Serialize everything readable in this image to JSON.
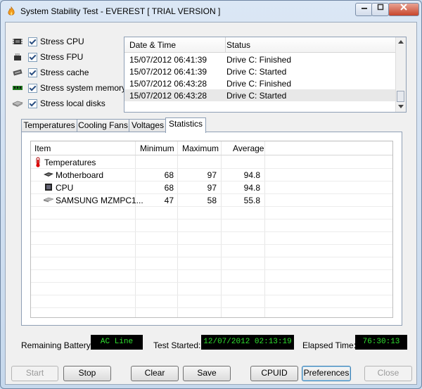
{
  "window": {
    "title": "System Stability Test - EVEREST  [ TRIAL VERSION ]"
  },
  "stress_options": [
    {
      "label": "Stress CPU",
      "icon": "cpu-icon",
      "checked": true
    },
    {
      "label": "Stress FPU",
      "icon": "fpu-icon",
      "checked": true
    },
    {
      "label": "Stress cache",
      "icon": "cache-icon",
      "checked": true
    },
    {
      "label": "Stress system memory",
      "icon": "memory-icon",
      "checked": true
    },
    {
      "label": "Stress local disks",
      "icon": "disk-icon",
      "checked": true
    }
  ],
  "log": {
    "columns": [
      "Date & Time",
      "Status"
    ],
    "rows": [
      {
        "time": "15/07/2012 06:41:39",
        "status": "Drive C: Finished"
      },
      {
        "time": "15/07/2012 06:41:39",
        "status": "Drive C: Started"
      },
      {
        "time": "15/07/2012 06:43:28",
        "status": "Drive C: Finished"
      },
      {
        "time": "15/07/2012 06:43:28",
        "status": "Drive C: Started"
      }
    ]
  },
  "tabs": [
    "Temperatures",
    "Cooling Fans",
    "Voltages",
    "Statistics"
  ],
  "active_tab": "Statistics",
  "statistics": {
    "columns": [
      "Item",
      "Minimum",
      "Maximum",
      "Average"
    ],
    "group": "Temperatures",
    "rows": [
      {
        "item": "Motherboard",
        "min": "68",
        "max": "97",
        "avg": "94.8"
      },
      {
        "item": "CPU",
        "min": "68",
        "max": "97",
        "avg": "94.8"
      },
      {
        "item": "SAMSUNG MZMPC1...",
        "min": "47",
        "max": "58",
        "avg": "55.8"
      }
    ]
  },
  "status_bar": {
    "battery_label": "Remaining Battery:",
    "battery_value": "AC Line",
    "started_label": "Test Started:",
    "started_value": "12/07/2012 02:13:19",
    "elapsed_label": "Elapsed Time:",
    "elapsed_value": "76:30:13"
  },
  "buttons": {
    "start": "Start",
    "stop": "Stop",
    "clear": "Clear",
    "save": "Save",
    "cpuid": "CPUID",
    "preferences": "Preferences",
    "close": "Close"
  },
  "colors": {
    "lcd_text": "#2ee02e",
    "lcd_bg": "#000000",
    "title_bg": "#c9dbee"
  }
}
